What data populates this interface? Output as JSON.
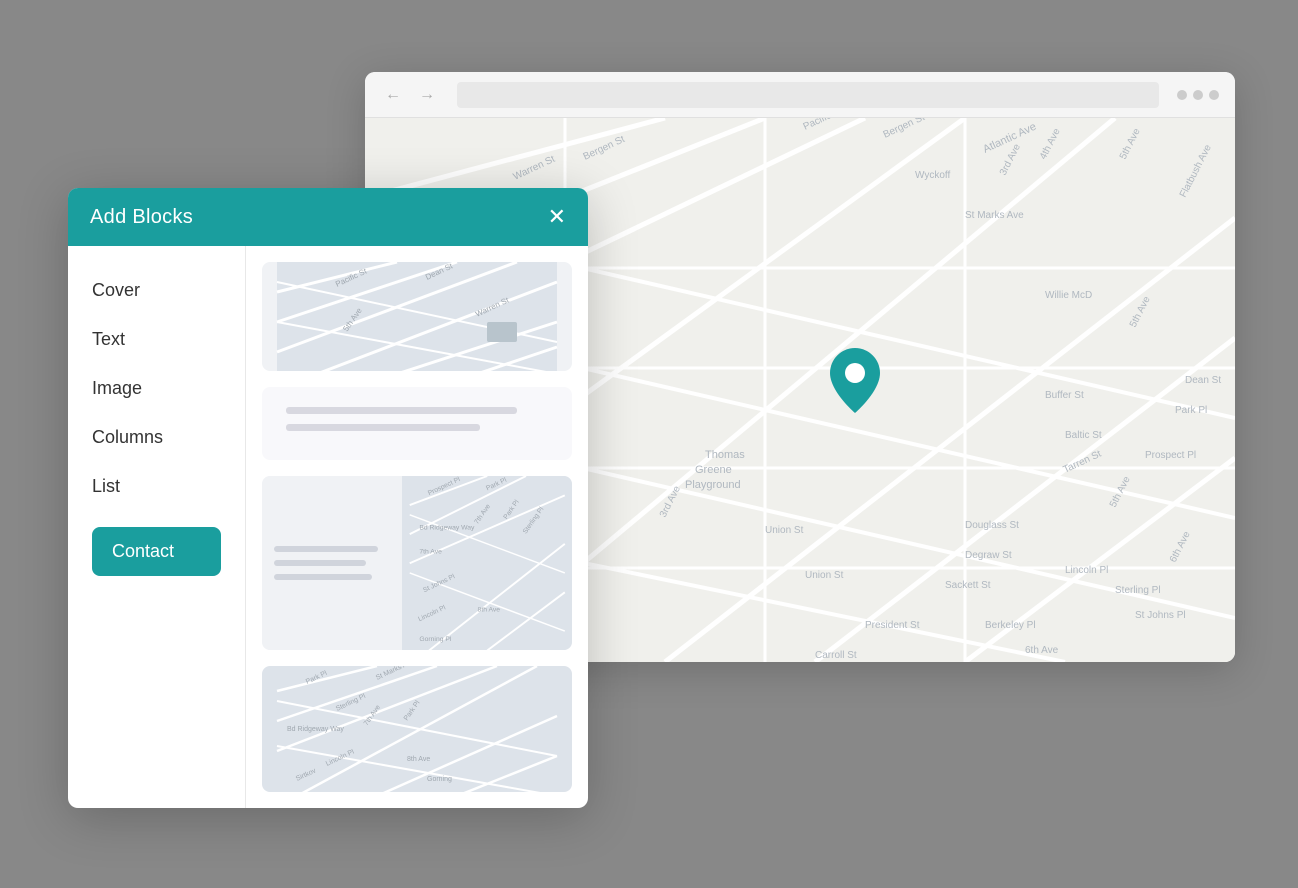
{
  "browser": {
    "nav_back": "←",
    "nav_forward": "→",
    "dots": [
      "dot1",
      "dot2",
      "dot3"
    ]
  },
  "panel": {
    "title": "Add Blocks",
    "close_label": "✕",
    "nav_items": [
      {
        "label": "Cover",
        "id": "cover"
      },
      {
        "label": "Text",
        "id": "text"
      },
      {
        "label": "Image",
        "id": "image"
      },
      {
        "label": "Columns",
        "id": "columns"
      },
      {
        "label": "List",
        "id": "list"
      }
    ],
    "contact_label": "Contact"
  },
  "map": {
    "pin_color": "#1a9e9e",
    "street_labels": [
      "Atlantic Ave",
      "Bergen St",
      "Pacific St",
      "Warren St",
      "Wyckoff Ave",
      "St Marks Ave",
      "Willie McD",
      "3rd Ave",
      "4th Ave",
      "5th Ave",
      "Buffer St",
      "Baltic St",
      "Thomas Greene Playground",
      "Union St",
      "Douglass St",
      "Degraw St",
      "Sackett St",
      "Lincoln Pl",
      "President St",
      "Carroll St",
      "Prospect Pl",
      "Park Pl",
      "Dean St",
      "Sterling Pl",
      "St Johns Pl"
    ]
  }
}
